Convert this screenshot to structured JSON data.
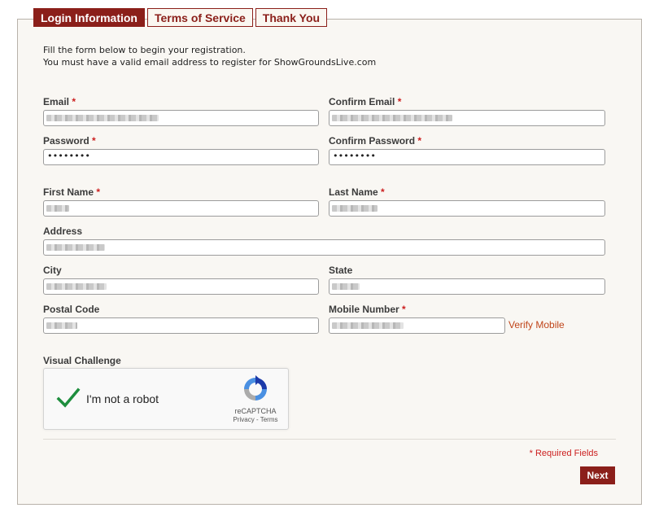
{
  "tabs": [
    {
      "label": "Login Information",
      "active": true
    },
    {
      "label": "Terms of Service",
      "active": false
    },
    {
      "label": "Thank You",
      "active": false
    }
  ],
  "intro": {
    "line1": "Fill the form below to begin your registration.",
    "line2": "You must have a valid email address to register for ShowGroundsLive.com"
  },
  "form": {
    "email": {
      "label": "Email",
      "required_mark": "*"
    },
    "confirm_email": {
      "label": "Confirm Email",
      "required_mark": "*"
    },
    "password": {
      "label": "Password",
      "required_mark": "*",
      "value": "••••••••"
    },
    "confirm_password": {
      "label": "Confirm Password",
      "required_mark": "*",
      "value": "••••••••"
    },
    "first_name": {
      "label": "First Name",
      "required_mark": "*"
    },
    "last_name": {
      "label": "Last Name",
      "required_mark": "*"
    },
    "address": {
      "label": "Address"
    },
    "city": {
      "label": "City"
    },
    "state": {
      "label": "State"
    },
    "postal_code": {
      "label": "Postal Code"
    },
    "mobile_number": {
      "label": "Mobile Number",
      "required_mark": "*"
    },
    "verify_mobile_link": "Verify Mobile",
    "visual_challenge": {
      "label": "Visual Challenge"
    }
  },
  "captcha": {
    "checkbox_text": "I'm not a robot",
    "brand": "reCAPTCHA",
    "links": "Privacy - Terms",
    "checked": true
  },
  "required_note": "* Required Fields",
  "next_button": "Next",
  "colors": {
    "brand": "#8b1f1a",
    "link": "#c0451a",
    "required": "#cc1f1f",
    "panel_bg": "#f9f7f3",
    "check": "#1e8e3e"
  }
}
